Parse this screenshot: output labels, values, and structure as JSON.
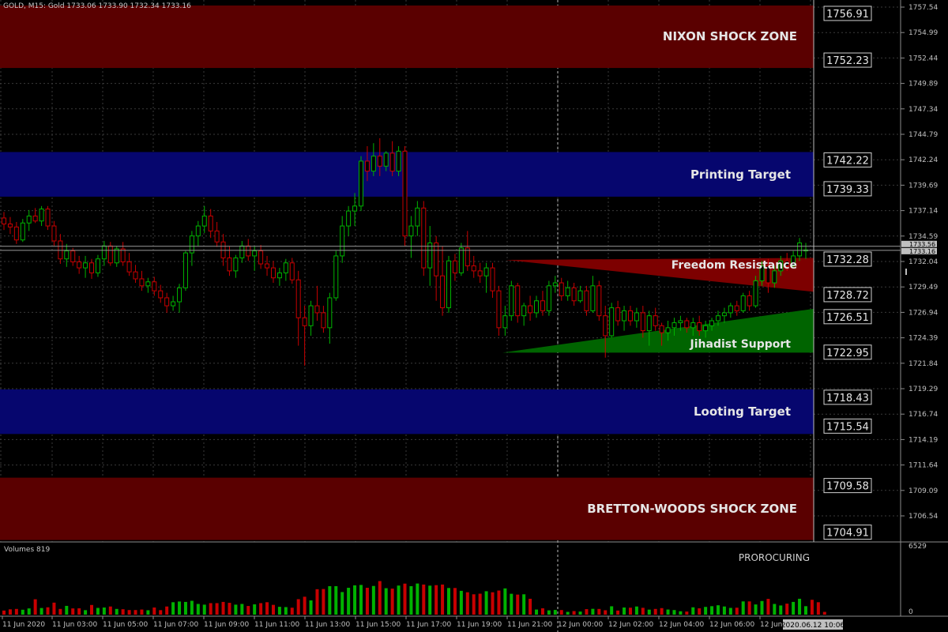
{
  "header": {
    "symbol_info": "GOLD, M15:  Gold  1733.06  1733.90  1732.34  1733.16",
    "volumes_label": "Volumes 819",
    "volume_max_label": "6529",
    "volume_zero_label": "0",
    "indicator_label": "PROROCURING"
  },
  "colors": {
    "background": "#000000",
    "grid": "#3a3a3a",
    "bull": "#00b300",
    "bear": "#c80000",
    "zone_red": "#5a0000",
    "zone_blue": "#06066e",
    "triangle_red": "#7d0000",
    "triangle_green": "#006400",
    "axis_text": "#c0c0c0"
  },
  "zones": [
    {
      "name": "NIXON SHOCK ZONE",
      "top": 1756.91,
      "bottom": 1752.23,
      "color": "red",
      "upper_label": "1756.91",
      "lower_label": "1752.23"
    },
    {
      "name": "Printing Target",
      "top": 1742.22,
      "bottom": 1739.33,
      "color": "blue",
      "upper_label": "1742.22",
      "lower_label": "1739.33"
    },
    {
      "name": "Looting Target",
      "top": 1718.43,
      "bottom": 1715.54,
      "color": "blue",
      "upper_label": "1718.43",
      "lower_label": "1715.54"
    },
    {
      "name": "BRETTON-WOODS SHOCK ZONE",
      "top": 1709.58,
      "bottom": 1704.91,
      "color": "red",
      "upper_label": "1709.58",
      "lower_label": "1704.91"
    }
  ],
  "triangles": [
    {
      "name": "Freedom Resistance",
      "label_level": "1732.28",
      "lower_level": "1728.72",
      "color": "red"
    },
    {
      "name": "Jihadist Support",
      "label_level": "1726.51",
      "lower_level": "1722.95",
      "color": "green"
    }
  ],
  "level_boxes": [
    "1756.91",
    "1752.23",
    "1742.22",
    "1739.33",
    "1732.28",
    "1728.72",
    "1726.51",
    "1722.95",
    "1718.43",
    "1715.54",
    "1709.58",
    "1704.91"
  ],
  "current_price": {
    "bid": "1733.16",
    "ask": "1733.56"
  },
  "chart_data": {
    "type": "candlestick",
    "symbol": "GOLD",
    "timeframe": "M15",
    "y_axis_ticks": [
      "1757.54",
      "1754.99",
      "1752.44",
      "1749.89",
      "1747.34",
      "1744.79",
      "1742.24",
      "1739.69",
      "1737.14",
      "1734.59",
      "1732.04",
      "1729.49",
      "1726.94",
      "1724.39",
      "1721.84",
      "1719.29",
      "1716.74",
      "1714.19",
      "1711.64",
      "1709.09",
      "1706.54"
    ],
    "x_axis_labels": [
      "11 Jun 2020",
      "11 Jun 03:00",
      "11 Jun 05:00",
      "11 Jun 07:00",
      "11 Jun 09:00",
      "11 Jun 11:00",
      "11 Jun 13:00",
      "11 Jun 15:00",
      "11 Jun 17:00",
      "11 Jun 19:00",
      "11 Jun 21:00",
      "12 Jun 00:00",
      "12 Jun 02:00",
      "12 Jun 04:00",
      "12 Jun 06:00",
      "12 Jun"
    ],
    "current_time_label": "2020.06.12 10:06",
    "ylim": [
      1704.4,
      1758.2
    ],
    "volume_max": 6529,
    "candles": [
      {
        "o": 1736.4,
        "h": 1737.0,
        "l": 1735.2,
        "c": 1735.8
      },
      {
        "o": 1735.8,
        "h": 1736.5,
        "l": 1734.8,
        "c": 1735.5
      },
      {
        "o": 1735.5,
        "h": 1736.0,
        "l": 1733.8,
        "c": 1734.2
      },
      {
        "o": 1734.2,
        "h": 1736.3,
        "l": 1734.0,
        "c": 1735.9
      },
      {
        "o": 1735.9,
        "h": 1737.2,
        "l": 1735.1,
        "c": 1736.6
      },
      {
        "o": 1736.6,
        "h": 1737.4,
        "l": 1735.9,
        "c": 1736.1
      },
      {
        "o": 1736.1,
        "h": 1737.6,
        "l": 1735.6,
        "c": 1737.3
      },
      {
        "o": 1737.3,
        "h": 1737.6,
        "l": 1735.2,
        "c": 1735.6
      },
      {
        "o": 1735.6,
        "h": 1736.1,
        "l": 1733.6,
        "c": 1734.1
      },
      {
        "o": 1734.1,
        "h": 1734.8,
        "l": 1731.8,
        "c": 1732.3
      },
      {
        "o": 1732.3,
        "h": 1733.8,
        "l": 1731.5,
        "c": 1733.1
      },
      {
        "o": 1733.1,
        "h": 1733.4,
        "l": 1731.6,
        "c": 1732.0
      },
      {
        "o": 1732.0,
        "h": 1732.6,
        "l": 1730.8,
        "c": 1731.4
      },
      {
        "o": 1731.4,
        "h": 1732.6,
        "l": 1730.4,
        "c": 1731.9
      },
      {
        "o": 1731.9,
        "h": 1732.3,
        "l": 1730.3,
        "c": 1730.9
      },
      {
        "o": 1730.9,
        "h": 1732.7,
        "l": 1730.5,
        "c": 1732.3
      },
      {
        "o": 1732.3,
        "h": 1734.1,
        "l": 1731.6,
        "c": 1733.6
      },
      {
        "o": 1733.6,
        "h": 1734.0,
        "l": 1731.6,
        "c": 1731.9
      },
      {
        "o": 1731.9,
        "h": 1733.6,
        "l": 1731.5,
        "c": 1733.3
      },
      {
        "o": 1733.3,
        "h": 1734.0,
        "l": 1731.6,
        "c": 1732.0
      },
      {
        "o": 1732.0,
        "h": 1732.9,
        "l": 1730.6,
        "c": 1731.0
      },
      {
        "o": 1731.0,
        "h": 1731.7,
        "l": 1729.9,
        "c": 1730.3
      },
      {
        "o": 1730.3,
        "h": 1731.1,
        "l": 1729.1,
        "c": 1729.6
      },
      {
        "o": 1729.6,
        "h": 1730.4,
        "l": 1728.9,
        "c": 1730.0
      },
      {
        "o": 1730.0,
        "h": 1730.5,
        "l": 1728.6,
        "c": 1729.1
      },
      {
        "o": 1729.1,
        "h": 1729.7,
        "l": 1727.9,
        "c": 1728.4
      },
      {
        "o": 1728.4,
        "h": 1728.9,
        "l": 1726.9,
        "c": 1727.6
      },
      {
        "o": 1727.6,
        "h": 1728.6,
        "l": 1727.1,
        "c": 1728.0
      },
      {
        "o": 1728.0,
        "h": 1729.8,
        "l": 1726.9,
        "c": 1729.4
      },
      {
        "o": 1729.4,
        "h": 1733.1,
        "l": 1729.1,
        "c": 1732.9
      },
      {
        "o": 1732.9,
        "h": 1735.1,
        "l": 1731.6,
        "c": 1734.6
      },
      {
        "o": 1734.6,
        "h": 1736.1,
        "l": 1733.6,
        "c": 1735.6
      },
      {
        "o": 1735.6,
        "h": 1737.6,
        "l": 1734.9,
        "c": 1736.6
      },
      {
        "o": 1736.6,
        "h": 1737.3,
        "l": 1734.4,
        "c": 1735.1
      },
      {
        "o": 1735.1,
        "h": 1736.0,
        "l": 1733.5,
        "c": 1734.0
      },
      {
        "o": 1734.0,
        "h": 1734.8,
        "l": 1731.6,
        "c": 1732.4
      },
      {
        "o": 1732.4,
        "h": 1733.6,
        "l": 1730.6,
        "c": 1731.1
      },
      {
        "o": 1731.1,
        "h": 1732.7,
        "l": 1730.4,
        "c": 1732.4
      },
      {
        "o": 1732.4,
        "h": 1734.1,
        "l": 1731.9,
        "c": 1733.6
      },
      {
        "o": 1733.6,
        "h": 1734.3,
        "l": 1732.1,
        "c": 1732.6
      },
      {
        "o": 1732.6,
        "h": 1733.6,
        "l": 1731.1,
        "c": 1733.1
      },
      {
        "o": 1733.1,
        "h": 1733.7,
        "l": 1731.3,
        "c": 1731.8
      },
      {
        "o": 1731.8,
        "h": 1732.6,
        "l": 1730.6,
        "c": 1731.4
      },
      {
        "o": 1731.4,
        "h": 1732.1,
        "l": 1729.9,
        "c": 1730.4
      },
      {
        "o": 1730.4,
        "h": 1731.4,
        "l": 1729.6,
        "c": 1730.9
      },
      {
        "o": 1730.9,
        "h": 1732.3,
        "l": 1730.1,
        "c": 1731.9
      },
      {
        "o": 1731.9,
        "h": 1732.4,
        "l": 1729.8,
        "c": 1730.2
      },
      {
        "o": 1730.2,
        "h": 1731.1,
        "l": 1723.6,
        "c": 1726.4
      },
      {
        "o": 1726.4,
        "h": 1727.6,
        "l": 1721.6,
        "c": 1725.6
      },
      {
        "o": 1725.6,
        "h": 1728.1,
        "l": 1724.6,
        "c": 1727.6
      },
      {
        "o": 1727.6,
        "h": 1729.6,
        "l": 1726.1,
        "c": 1726.9
      },
      {
        "o": 1726.9,
        "h": 1727.6,
        "l": 1724.9,
        "c": 1725.4
      },
      {
        "o": 1725.4,
        "h": 1728.9,
        "l": 1723.8,
        "c": 1728.4
      },
      {
        "o": 1728.4,
        "h": 1733.1,
        "l": 1728.1,
        "c": 1732.6
      },
      {
        "o": 1732.6,
        "h": 1736.6,
        "l": 1731.9,
        "c": 1735.6
      },
      {
        "o": 1735.6,
        "h": 1737.6,
        "l": 1734.6,
        "c": 1737.1
      },
      {
        "o": 1737.1,
        "h": 1738.9,
        "l": 1735.6,
        "c": 1737.6
      },
      {
        "o": 1737.6,
        "h": 1742.6,
        "l": 1737.1,
        "c": 1742.1
      },
      {
        "o": 1742.1,
        "h": 1743.6,
        "l": 1740.1,
        "c": 1741.1
      },
      {
        "o": 1741.1,
        "h": 1743.9,
        "l": 1740.6,
        "c": 1742.6
      },
      {
        "o": 1742.6,
        "h": 1744.4,
        "l": 1740.6,
        "c": 1741.6
      },
      {
        "o": 1741.6,
        "h": 1743.1,
        "l": 1741.1,
        "c": 1742.9
      },
      {
        "o": 1742.9,
        "h": 1744.1,
        "l": 1740.6,
        "c": 1741.1
      },
      {
        "o": 1741.1,
        "h": 1743.6,
        "l": 1740.6,
        "c": 1743.1
      },
      {
        "o": 1743.1,
        "h": 1743.6,
        "l": 1733.6,
        "c": 1734.6
      },
      {
        "o": 1734.6,
        "h": 1736.6,
        "l": 1732.4,
        "c": 1735.6
      },
      {
        "o": 1735.6,
        "h": 1738.1,
        "l": 1734.6,
        "c": 1737.4
      },
      {
        "o": 1737.4,
        "h": 1738.1,
        "l": 1730.6,
        "c": 1731.4
      },
      {
        "o": 1731.4,
        "h": 1735.6,
        "l": 1729.6,
        "c": 1733.9
      },
      {
        "o": 1733.9,
        "h": 1734.6,
        "l": 1728.1,
        "c": 1730.6
      },
      {
        "o": 1730.6,
        "h": 1733.6,
        "l": 1726.6,
        "c": 1727.4
      },
      {
        "o": 1727.4,
        "h": 1732.6,
        "l": 1726.9,
        "c": 1732.1
      },
      {
        "o": 1732.1,
        "h": 1732.8,
        "l": 1730.1,
        "c": 1730.9
      },
      {
        "o": 1730.9,
        "h": 1733.9,
        "l": 1730.6,
        "c": 1733.4
      },
      {
        "o": 1733.4,
        "h": 1735.1,
        "l": 1731.1,
        "c": 1731.6
      },
      {
        "o": 1731.6,
        "h": 1732.6,
        "l": 1730.4,
        "c": 1731.1
      },
      {
        "o": 1731.1,
        "h": 1731.9,
        "l": 1729.9,
        "c": 1730.6
      },
      {
        "o": 1730.6,
        "h": 1731.9,
        "l": 1728.9,
        "c": 1731.4
      },
      {
        "o": 1731.4,
        "h": 1731.9,
        "l": 1728.4,
        "c": 1729.1
      },
      {
        "o": 1729.1,
        "h": 1729.6,
        "l": 1724.6,
        "c": 1725.4
      },
      {
        "o": 1725.4,
        "h": 1727.6,
        "l": 1724.6,
        "c": 1726.6
      },
      {
        "o": 1726.6,
        "h": 1730.1,
        "l": 1726.1,
        "c": 1729.6
      },
      {
        "o": 1729.6,
        "h": 1729.9,
        "l": 1725.9,
        "c": 1726.6
      },
      {
        "o": 1726.6,
        "h": 1727.9,
        "l": 1725.6,
        "c": 1727.6
      },
      {
        "o": 1727.6,
        "h": 1728.6,
        "l": 1726.1,
        "c": 1726.9
      },
      {
        "o": 1726.9,
        "h": 1728.6,
        "l": 1726.4,
        "c": 1728.1
      },
      {
        "o": 1728.1,
        "h": 1729.1,
        "l": 1726.6,
        "c": 1727.1
      },
      {
        "o": 1727.1,
        "h": 1730.1,
        "l": 1726.6,
        "c": 1729.6
      },
      {
        "o": 1729.6,
        "h": 1730.6,
        "l": 1728.9,
        "c": 1729.9
      },
      {
        "o": 1729.9,
        "h": 1730.4,
        "l": 1728.1,
        "c": 1728.6
      },
      {
        "o": 1728.6,
        "h": 1730.1,
        "l": 1728.1,
        "c": 1729.4
      },
      {
        "o": 1729.4,
        "h": 1729.9,
        "l": 1727.6,
        "c": 1728.1
      },
      {
        "o": 1728.1,
        "h": 1729.6,
        "l": 1727.9,
        "c": 1729.1
      },
      {
        "o": 1729.1,
        "h": 1729.6,
        "l": 1726.6,
        "c": 1727.1
      },
      {
        "o": 1727.1,
        "h": 1730.6,
        "l": 1726.9,
        "c": 1729.6
      },
      {
        "o": 1729.6,
        "h": 1730.1,
        "l": 1726.1,
        "c": 1726.6
      },
      {
        "o": 1726.6,
        "h": 1727.6,
        "l": 1722.4,
        "c": 1724.6
      },
      {
        "o": 1724.6,
        "h": 1727.9,
        "l": 1724.4,
        "c": 1727.4
      },
      {
        "o": 1727.4,
        "h": 1728.1,
        "l": 1725.6,
        "c": 1726.1
      },
      {
        "o": 1726.1,
        "h": 1727.6,
        "l": 1725.1,
        "c": 1727.1
      },
      {
        "o": 1727.1,
        "h": 1727.6,
        "l": 1725.6,
        "c": 1726.1
      },
      {
        "o": 1726.1,
        "h": 1727.4,
        "l": 1725.4,
        "c": 1726.9
      },
      {
        "o": 1726.9,
        "h": 1727.6,
        "l": 1724.4,
        "c": 1725.1
      },
      {
        "o": 1725.1,
        "h": 1727.1,
        "l": 1723.6,
        "c": 1726.6
      },
      {
        "o": 1726.6,
        "h": 1727.4,
        "l": 1725.1,
        "c": 1725.6
      },
      {
        "o": 1725.6,
        "h": 1725.9,
        "l": 1723.6,
        "c": 1724.9
      },
      {
        "o": 1724.9,
        "h": 1726.1,
        "l": 1724.1,
        "c": 1725.4
      },
      {
        "o": 1725.4,
        "h": 1726.4,
        "l": 1724.6,
        "c": 1725.9
      },
      {
        "o": 1725.9,
        "h": 1726.6,
        "l": 1725.1,
        "c": 1726.1
      },
      {
        "o": 1726.1,
        "h": 1726.4,
        "l": 1724.9,
        "c": 1725.4
      },
      {
        "o": 1725.4,
        "h": 1726.4,
        "l": 1724.6,
        "c": 1725.9
      },
      {
        "o": 1725.9,
        "h": 1726.6,
        "l": 1724.6,
        "c": 1725.1
      },
      {
        "o": 1725.1,
        "h": 1726.1,
        "l": 1724.4,
        "c": 1725.6
      },
      {
        "o": 1725.6,
        "h": 1726.4,
        "l": 1725.1,
        "c": 1726.1
      },
      {
        "o": 1726.1,
        "h": 1727.1,
        "l": 1725.6,
        "c": 1726.6
      },
      {
        "o": 1726.6,
        "h": 1727.4,
        "l": 1725.9,
        "c": 1726.9
      },
      {
        "o": 1726.9,
        "h": 1727.9,
        "l": 1726.4,
        "c": 1727.6
      },
      {
        "o": 1727.6,
        "h": 1728.1,
        "l": 1726.6,
        "c": 1727.1
      },
      {
        "o": 1727.1,
        "h": 1728.9,
        "l": 1726.9,
        "c": 1728.6
      },
      {
        "o": 1728.6,
        "h": 1729.1,
        "l": 1727.1,
        "c": 1727.6
      },
      {
        "o": 1727.6,
        "h": 1730.6,
        "l": 1727.4,
        "c": 1730.1
      },
      {
        "o": 1730.1,
        "h": 1732.1,
        "l": 1729.6,
        "c": 1731.6
      },
      {
        "o": 1731.6,
        "h": 1732.3,
        "l": 1728.9,
        "c": 1729.9
      },
      {
        "o": 1729.9,
        "h": 1731.6,
        "l": 1729.4,
        "c": 1731.1
      },
      {
        "o": 1731.1,
        "h": 1732.6,
        "l": 1730.6,
        "c": 1732.1
      },
      {
        "o": 1732.1,
        "h": 1732.9,
        "l": 1731.1,
        "c": 1731.6
      },
      {
        "o": 1731.6,
        "h": 1733.1,
        "l": 1731.4,
        "c": 1732.6
      },
      {
        "o": 1732.6,
        "h": 1734.4,
        "l": 1732.1,
        "c": 1733.9
      },
      {
        "o": 1733.1,
        "h": 1733.9,
        "l": 1732.3,
        "c": 1733.2
      }
    ],
    "volumes": [
      400,
      520,
      560,
      480,
      610,
      1510,
      650,
      720,
      1180,
      560,
      860,
      610,
      620,
      440,
      950,
      660,
      700,
      800,
      560,
      530,
      450,
      450,
      500,
      430,
      700,
      440,
      800,
      1220,
      1290,
      1250,
      1360,
      1050,
      980,
      1130,
      1130,
      1250,
      1160,
      980,
      1050,
      850,
      1010,
      1130,
      1220,
      960,
      770,
      740,
      680,
      1520,
      1760,
      1400,
      2500,
      2520,
      2800,
      2800,
      2220,
      2640,
      2880,
      2920,
      2640,
      2820,
      3300,
      2600,
      2560,
      2860,
      3050,
      2800,
      3060,
      2960,
      2850,
      2900,
      2960,
      2620,
      2620,
      2340,
      2200,
      2000,
      2060,
      2300,
      2200,
      2370,
      2580,
      2050,
      1970,
      2000,
      1560,
      500,
      620,
      420,
      460,
      450,
      270,
      350,
      300,
      540,
      570,
      560,
      430,
      820,
      400,
      700,
      680,
      800,
      670,
      490,
      560,
      640,
      500,
      450,
      330,
      300,
      720,
      620,
      760,
      830,
      920,
      800,
      660,
      680,
      1300,
      1300,
      1000,
      1340,
      1550,
      1050,
      900,
      1080,
      1250,
      1560,
      830,
      1460,
      1220,
      270
    ]
  }
}
